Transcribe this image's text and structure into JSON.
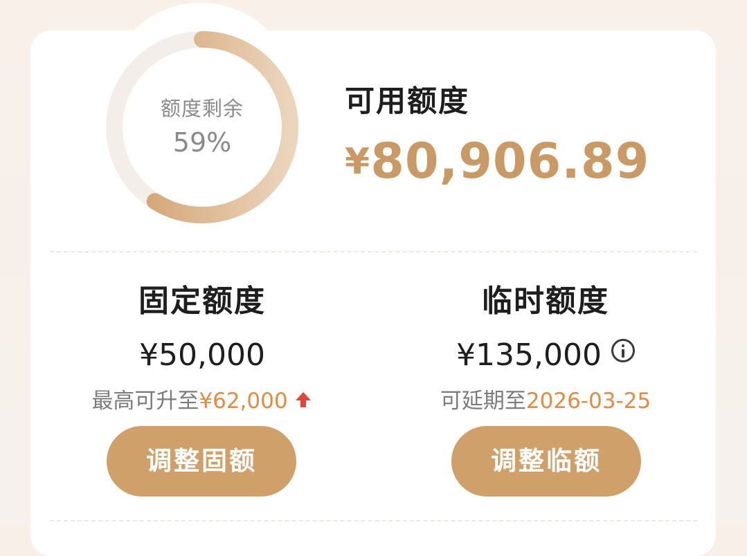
{
  "quota_ring": {
    "label": "额度剩余",
    "percent_text": "59%",
    "remaining_fraction": 0.59,
    "color": "#cfa06a"
  },
  "available": {
    "title": "可用额度",
    "amount": "¥80,906.89",
    "color": "#c99a66"
  },
  "fixed": {
    "title": "固定额度",
    "amount": "¥50,000",
    "max_prefix": "最高可升至",
    "max_amount": "¥62,000",
    "button_label": "调整固额"
  },
  "temporary": {
    "title": "临时额度",
    "amount": "¥135,000",
    "extend_prefix": "可延期至",
    "extend_date": "2026-03-25",
    "button_label": "调整临额"
  },
  "icons": {
    "info": "info-circle-icon",
    "increase": "up-arrow-icon"
  },
  "colors": {
    "accent": "#cfa06a",
    "highlight": "#e28a47",
    "arrow": "#e04535"
  }
}
